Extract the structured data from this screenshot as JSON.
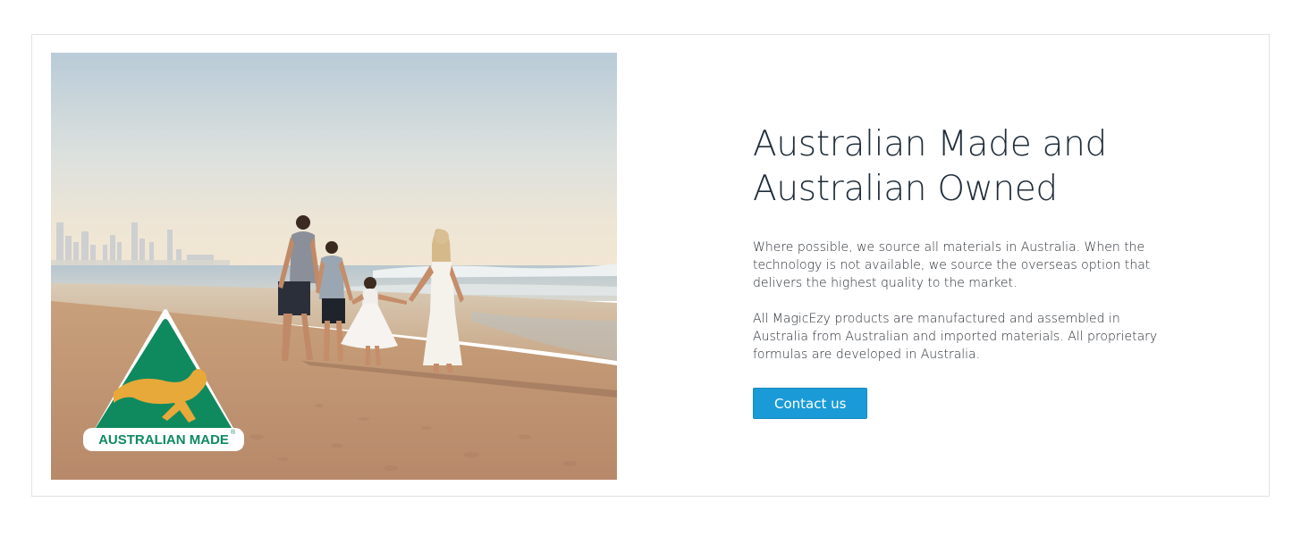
{
  "feature": {
    "image_alt": "Family walking hand in hand along a beach at sunset with city skyline in the distance",
    "logo_text": "AUSTRALIAN MADE",
    "logo_registered": "®",
    "headline_line1": "Australian Made and",
    "headline_line2": "Australian Owned",
    "paragraph1_line1": "Where possible, we source all materials in Australia. When the",
    "paragraph1_line2": "technology is not available, we source the overseas option that",
    "paragraph1_line3": "delivers the highest quality to the market.",
    "paragraph2_line1": "All MagicEzy products are manufactured and assembled in",
    "paragraph2_line2": "Australia from Australian and imported materials. All proprietary",
    "paragraph2_line3": "formulas are developed in Australia.",
    "cta_label": "Contact us"
  },
  "colors": {
    "heading": "#1f2d3a",
    "body_text": "#2a2f36",
    "button_bg": "#1a9bd7",
    "button_text": "#ffffff",
    "logo_green": "#0f8a5f",
    "logo_gold": "#e7a93a"
  }
}
